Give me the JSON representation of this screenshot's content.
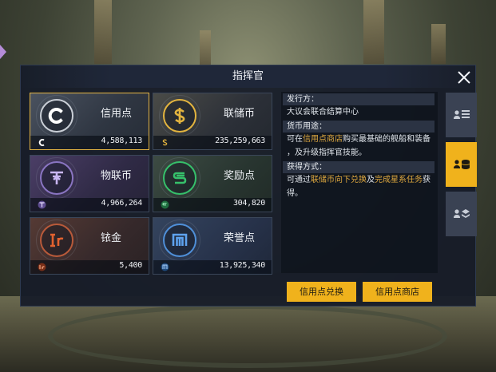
{
  "dialog": {
    "title": "指挥官"
  },
  "currencies": [
    {
      "name": "信用点",
      "amount": "4,588,113",
      "icon": "credit-icon",
      "color": "#ffffff",
      "selected": true
    },
    {
      "name": "联储币",
      "amount": "235,259,663",
      "icon": "federal-coin-icon",
      "color": "#e3b43f",
      "selected": false
    },
    {
      "name": "物联币",
      "amount": "4,966,264",
      "icon": "iot-coin-icon",
      "color": "#b49be6",
      "selected": false
    },
    {
      "name": "奖励点",
      "amount": "304,820",
      "icon": "reward-point-icon",
      "color": "#36c06b",
      "selected": false
    },
    {
      "name": "铱金",
      "amount": "5,400",
      "icon": "iridium-icon",
      "color": "#e2622f",
      "selected": false
    },
    {
      "name": "荣誉点",
      "amount": "13,925,340",
      "icon": "honor-point-icon",
      "color": "#4f8fd8",
      "selected": false
    }
  ],
  "info": {
    "issuer_label": "发行方：",
    "issuer_value": "大议会联合结算中心",
    "usage_label": "货币用途：",
    "usage_prefix": "可在",
    "usage_link": "信用点商店",
    "usage_suffix": "购买最基础的舰船和装备",
    "usage_line2": "，及升级指挥官技能。",
    "obtain_label": "获得方式：",
    "obtain_prefix": "可通过",
    "obtain_link1": "联储币向下兑换",
    "obtain_mid": "及",
    "obtain_link2": "完成星系任务",
    "obtain_suffix": "获",
    "obtain_line2": "得。"
  },
  "buttons": {
    "exchange": "信用点兑换",
    "shop": "信用点商店"
  },
  "tabs": [
    {
      "icon": "commander-list-icon",
      "active": false
    },
    {
      "icon": "commander-currency-icon",
      "active": true
    },
    {
      "icon": "commander-items-icon",
      "active": false
    }
  ],
  "colors": {
    "accent": "#f0b21c",
    "highlight_text": "#e0a93f",
    "panel": "#161c28"
  }
}
